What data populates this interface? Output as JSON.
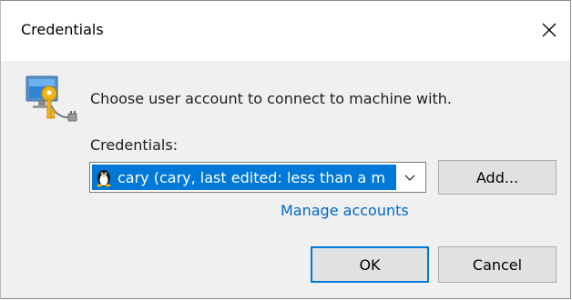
{
  "window": {
    "title": "Credentials",
    "close_icon": "close-icon"
  },
  "main": {
    "icon": "computer-key-icon",
    "prompt": "Choose user account to connect to machine with.",
    "credentials_label": "Credentials:",
    "credentials_select": {
      "selected_value": "cary (cary, last edited: less than a m",
      "item_icon": "tux-linux-icon",
      "dropdown_icon": "chevron-down-icon"
    },
    "add_button": "Add...",
    "manage_link": "Manage accounts"
  },
  "footer": {
    "ok_button": "OK",
    "cancel_button": "Cancel"
  },
  "colors": {
    "accent": "#0078d7",
    "link": "#0066cc",
    "dialog_bg": "#f0f0f0"
  }
}
